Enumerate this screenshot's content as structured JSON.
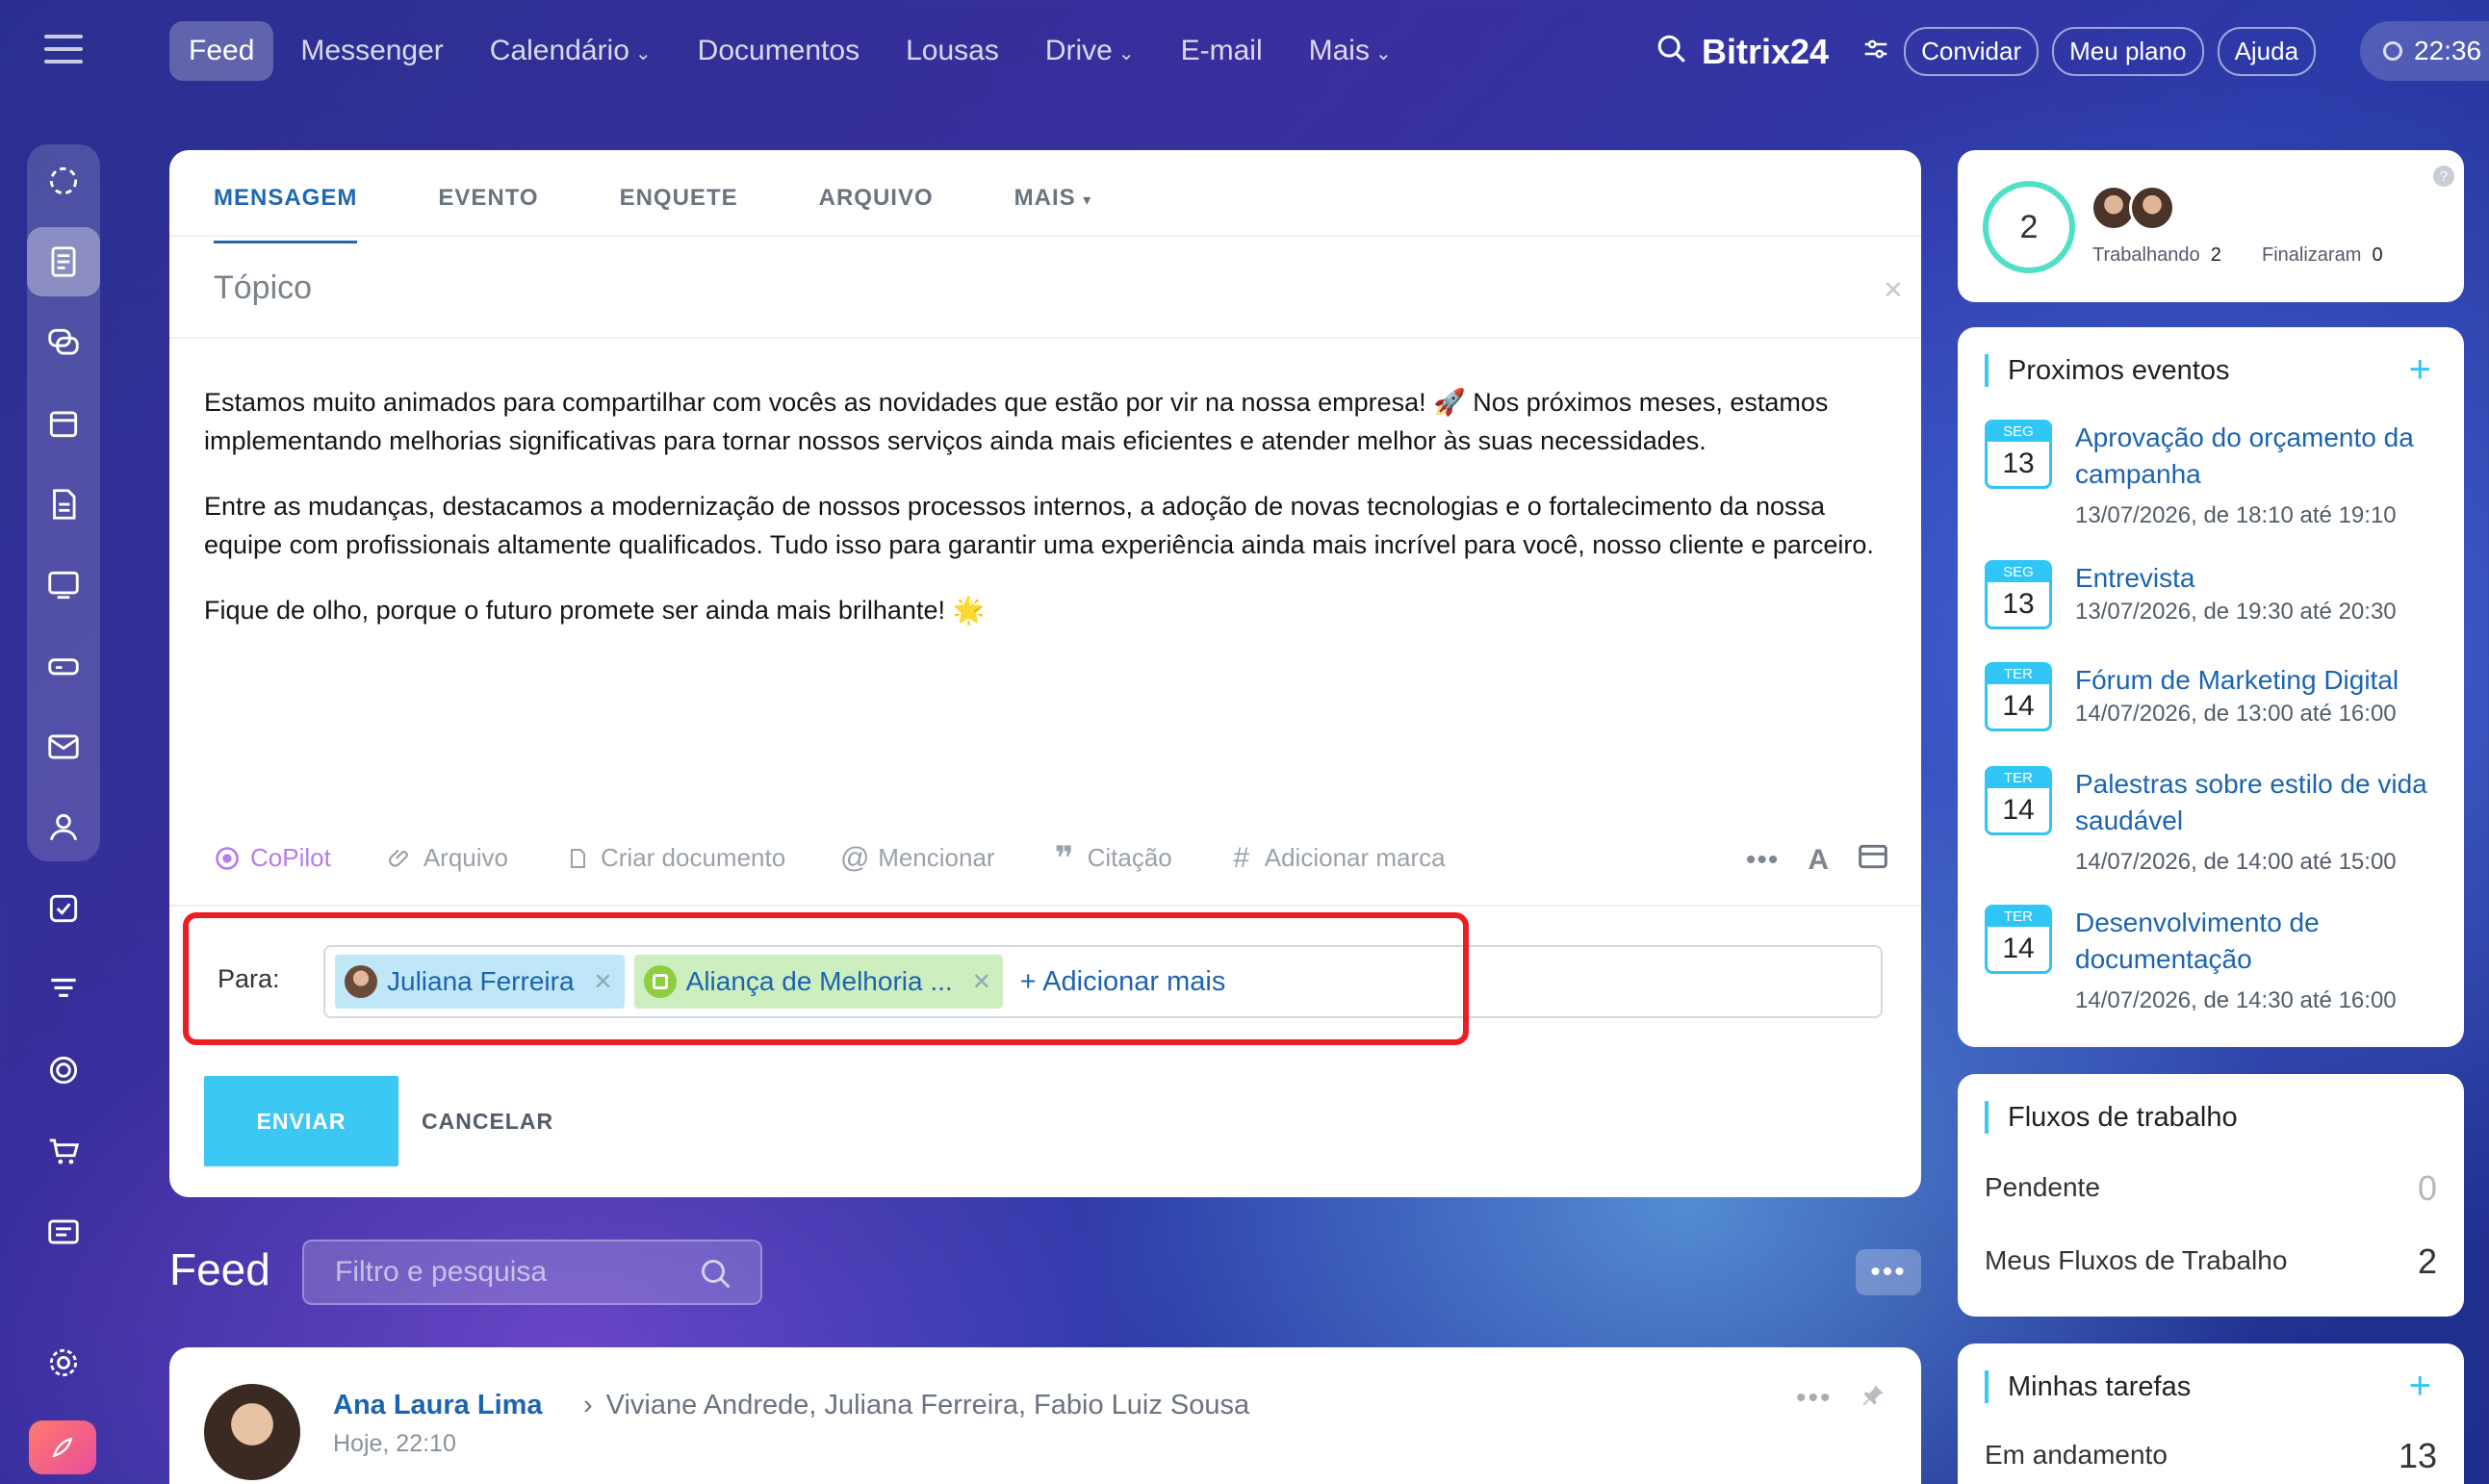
{
  "topbar": {
    "nav": [
      {
        "label": "Feed",
        "active": true,
        "dropdown": false
      },
      {
        "label": "Messenger",
        "active": false,
        "dropdown": false
      },
      {
        "label": "Calendário",
        "active": false,
        "dropdown": true
      },
      {
        "label": "Documentos",
        "active": false,
        "dropdown": false
      },
      {
        "label": "Lousas",
        "active": false,
        "dropdown": false
      },
      {
        "label": "Drive",
        "active": false,
        "dropdown": true
      },
      {
        "label": "E-mail",
        "active": false,
        "dropdown": false
      },
      {
        "label": "Mais",
        "active": false,
        "dropdown": true
      }
    ],
    "brand": "Bitrix24",
    "invite": "Convidar",
    "plan": "Meu plano",
    "help": "Ajuda",
    "clock": "22:36"
  },
  "sidebar": {
    "icons": [
      "activity-icon",
      "news-icon",
      "chat-icon",
      "calendar-icon",
      "document-icon",
      "board-icon",
      "drive-icon",
      "mail-icon",
      "contacts-icon",
      "tasks-icon",
      "crm-icon",
      "target-icon",
      "cart-icon",
      "profile-card-icon",
      "settings-icon"
    ]
  },
  "composer": {
    "tabs": [
      {
        "label": "MENSAGEM",
        "active": true
      },
      {
        "label": "EVENTO",
        "active": false
      },
      {
        "label": "ENQUETE",
        "active": false
      },
      {
        "label": "ARQUIVO",
        "active": false
      },
      {
        "label": "MAIS",
        "active": false
      }
    ],
    "topic_placeholder": "Tópico",
    "paragraphs": [
      "Estamos muito animados para compartilhar com vocês as novidades que estão por vir na nossa empresa! 🚀 Nos próximos meses, estamos implementando melhorias significativas para tornar nossos serviços ainda mais eficientes e atender melhor às suas necessidades.",
      "Entre as mudanças, destacamos a modernização de nossos processos internos, a adoção de novas tecnologias e o fortalecimento da nossa equipe com profissionais altamente qualificados. Tudo isso para garantir uma experiência ainda mais incrível para você, nosso cliente e parceiro.",
      "Fique de olho, porque o futuro promete ser ainda mais brilhante! 🌟"
    ],
    "tools": {
      "copilot": "CoPilot",
      "file": "Arquivo",
      "create_doc": "Criar documento",
      "mention": "Mencionar",
      "quote": "Citação",
      "tag": "Adicionar marca"
    },
    "to_label": "Para:",
    "recipients": [
      "Juliana Ferreira",
      "Aliança de Melhoria ..."
    ],
    "add_more": "+ Adicionar mais",
    "send": "ENVIAR",
    "cancel": "CANCELAR"
  },
  "feed": {
    "title": "Feed",
    "search_placeholder": "Filtro e pesquisa",
    "post": {
      "author": "Ana Laura Lima",
      "recipients": "Viviane Andrede, Juliana Ferreira, Fabio Luiz Sousa",
      "time": "Hoje, 22:10"
    }
  },
  "worktime": {
    "count": "2",
    "working_label": "Trabalhando",
    "working_value": "2",
    "finished_label": "Finalizaram",
    "finished_value": "0"
  },
  "events": {
    "title": "Proximos eventos",
    "items": [
      {
        "weekday": "SEG",
        "day": "13",
        "title": "Aprovação do orçamento da campanha",
        "time": "13/07/2026, de 18:10 até 19:10"
      },
      {
        "weekday": "SEG",
        "day": "13",
        "title": "Entrevista",
        "time": "13/07/2026, de 19:30 até 20:30"
      },
      {
        "weekday": "TER",
        "day": "14",
        "title": "Fórum de Marketing Digital",
        "time": "14/07/2026, de 13:00 até 16:00"
      },
      {
        "weekday": "TER",
        "day": "14",
        "title": "Palestras sobre estilo de vida saudável",
        "time": "14/07/2026, de 14:00 até 15:00"
      },
      {
        "weekday": "TER",
        "day": "14",
        "title": "Desenvolvimento de documentação",
        "time": "14/07/2026, de 14:30 até 16:00"
      }
    ]
  },
  "workflows": {
    "title": "Fluxos de trabalho",
    "pending_label": "Pendente",
    "pending_value": "0",
    "mine_label": "Meus Fluxos de Trabalho",
    "mine_value": "2"
  },
  "tasks": {
    "title": "Minhas tarefas",
    "in_progress_label": "Em andamento",
    "in_progress_value": "13"
  },
  "colors": {
    "accent": "#2fc6f6",
    "link": "#1c64b0",
    "highlight": "#ee1d24",
    "send_button": "#3bc8f5"
  }
}
